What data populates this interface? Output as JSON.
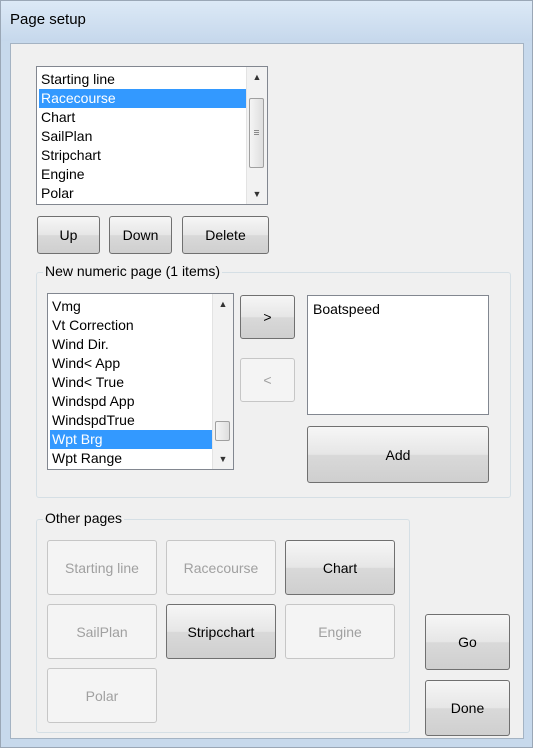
{
  "window": {
    "title": "Page setup"
  },
  "pages_list": {
    "items": [
      "Starting line",
      "Racecourse",
      "Chart",
      "SailPlan",
      "Stripchart",
      "Engine",
      "Polar"
    ],
    "selected": "Racecourse"
  },
  "page_buttons": {
    "up": "Up",
    "down": "Down",
    "delete": "Delete"
  },
  "numeric_group": {
    "legend": "New numeric page (1 items)",
    "available": {
      "items": [
        "Vmg",
        "Vt Correction",
        "Wind Dir.",
        "Wind< App",
        "Wind< True",
        "Windspd App",
        "WindspdTrue",
        "Wpt Brg",
        "Wpt Range"
      ],
      "selected": "Wpt Brg"
    },
    "move_right": ">",
    "move_left": "<",
    "selected_items": [
      "Boatspeed"
    ],
    "add": "Add"
  },
  "other_pages": {
    "legend": "Other pages",
    "buttons": [
      {
        "label": "Starting line",
        "enabled": false
      },
      {
        "label": "Racecourse",
        "enabled": false
      },
      {
        "label": "Chart",
        "enabled": true
      },
      {
        "label": "SailPlan",
        "enabled": false
      },
      {
        "label": "Stripcchart",
        "enabled": true
      },
      {
        "label": "Engine",
        "enabled": false
      },
      {
        "label": "Polar",
        "enabled": false
      }
    ]
  },
  "actions": {
    "go": "Go",
    "done": "Done"
  },
  "icons": {
    "scroll_up": "scroll-up-arrow-icon",
    "scroll_down": "scroll-down-arrow-icon",
    "scroll_grip": "scroll-grip-icon"
  },
  "colors": {
    "selection": "#3399ff",
    "frame": "#c7d9ec",
    "dialog_bg": "#f0f0f0"
  }
}
